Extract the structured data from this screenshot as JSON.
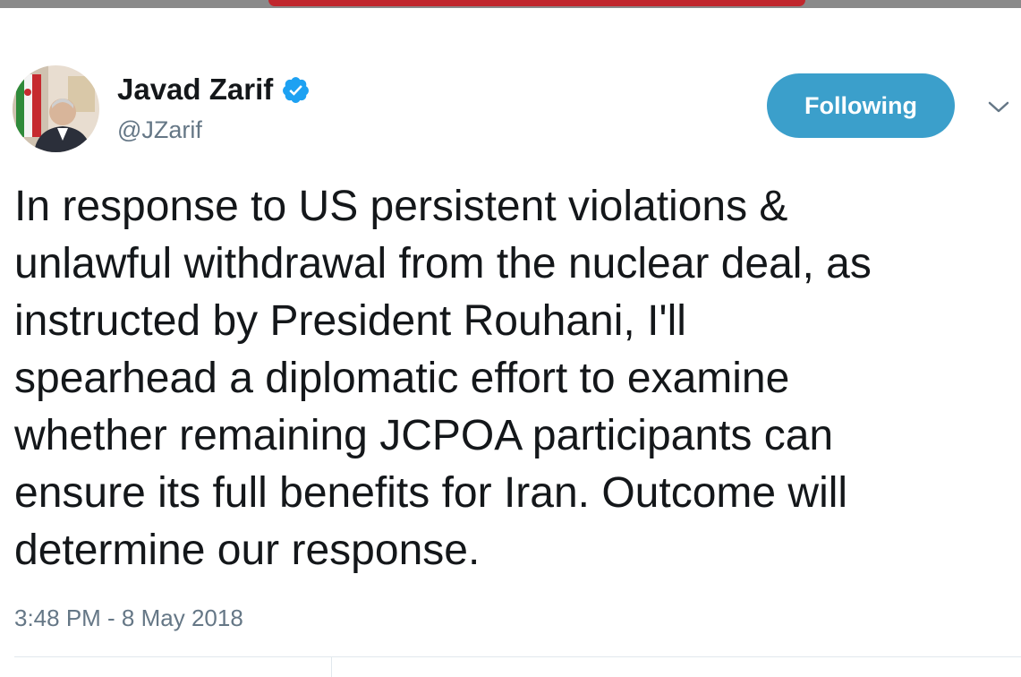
{
  "tweet": {
    "author": {
      "display_name": "Javad Zarif",
      "handle": "@JZarif",
      "verified_icon": "verified-badge-icon"
    },
    "follow_button_label": "Following",
    "more_icon": "chevron-down-icon",
    "text_lines": [
      "In response to US persistent violations &",
      "unlawful withdrawal from the nuclear deal, as",
      "instructed by President Rouhani, I'll",
      "spearhead a diplomatic effort to examine",
      "whether remaining JCPOA participants can",
      "ensure its full benefits for Iran. Outcome will",
      "determine our response."
    ],
    "timestamp": "3:48 PM - 8 May 2018"
  },
  "colors": {
    "accent": "#3b9fcb",
    "verified": "#1da1f2",
    "secondary_text": "#657786",
    "primary_text": "#14171a"
  }
}
